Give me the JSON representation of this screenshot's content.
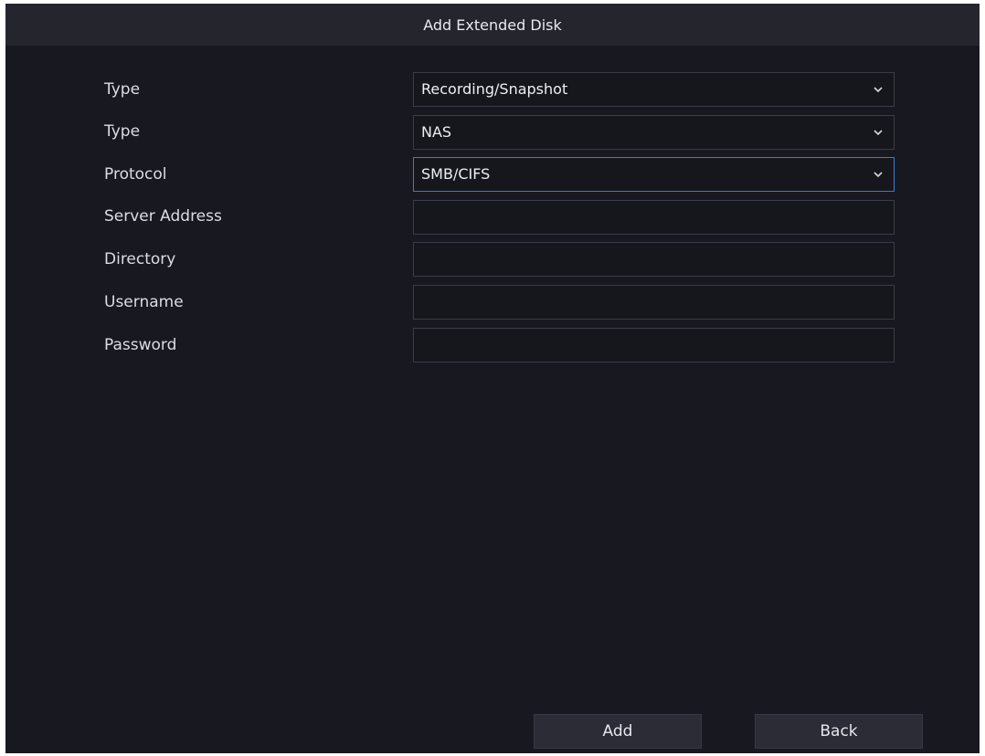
{
  "dialog": {
    "title": "Add Extended Disk"
  },
  "form": {
    "fields": [
      {
        "label": "Type",
        "kind": "select",
        "value": "Recording/Snapshot"
      },
      {
        "label": "Type",
        "kind": "select",
        "value": "NAS"
      },
      {
        "label": "Protocol",
        "kind": "select",
        "value": "SMB/CIFS",
        "focused": true
      },
      {
        "label": "Server Address",
        "kind": "text",
        "value": ""
      },
      {
        "label": "Directory",
        "kind": "text",
        "value": ""
      },
      {
        "label": "Username",
        "kind": "text",
        "value": ""
      },
      {
        "label": "Password",
        "kind": "password",
        "value": ""
      }
    ]
  },
  "buttons": {
    "add_label": "Add",
    "back_label": "Back"
  },
  "icons": {
    "dropdown": "chevron-down-icon"
  },
  "colors": {
    "background": "#181820",
    "titlebar": "#25252e",
    "focus_border": "#3a7bd2",
    "button": "#2c2c36"
  }
}
